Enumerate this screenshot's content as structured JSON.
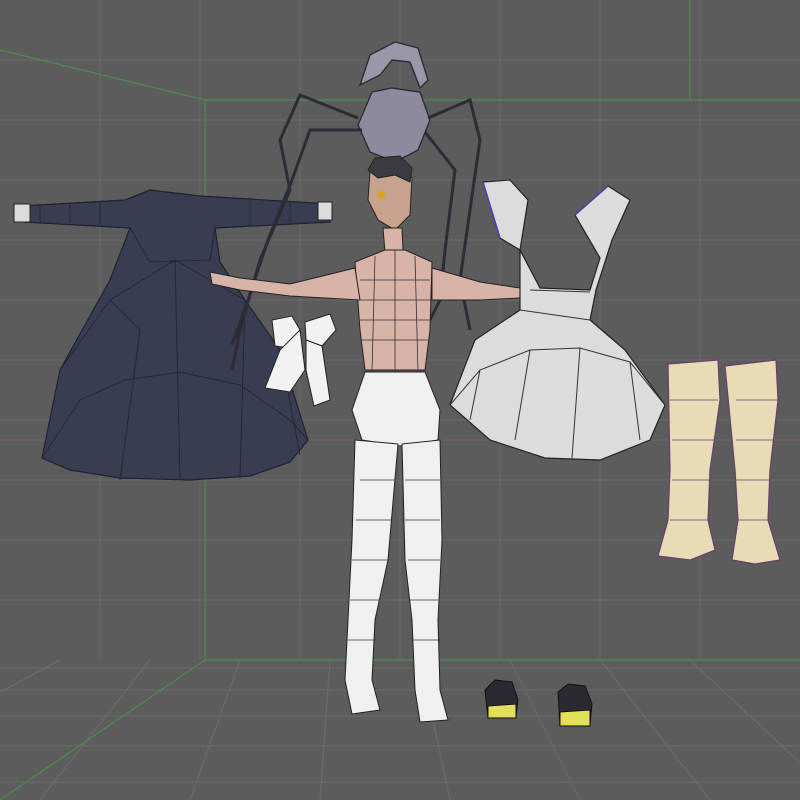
{
  "viewport": {
    "background": "#5c5c5c",
    "grid_color": "#6e6e6e",
    "axis_color": "#7a5f7a",
    "bound_color": "#4f8a4f"
  },
  "assets": [
    {
      "name": "black-dress",
      "color": "#3a3d52"
    },
    {
      "name": "figure-body",
      "color": "#d8b3a8"
    },
    {
      "name": "spider-hair-accessory",
      "color": "#8f8c9e"
    },
    {
      "name": "ribbon-bows",
      "color": "#f2f2f2"
    },
    {
      "name": "white-dress",
      "color": "#dcdcdc"
    },
    {
      "name": "boots",
      "color": "#e8dcb6"
    },
    {
      "name": "shoes",
      "color": "#2a2a30"
    }
  ]
}
